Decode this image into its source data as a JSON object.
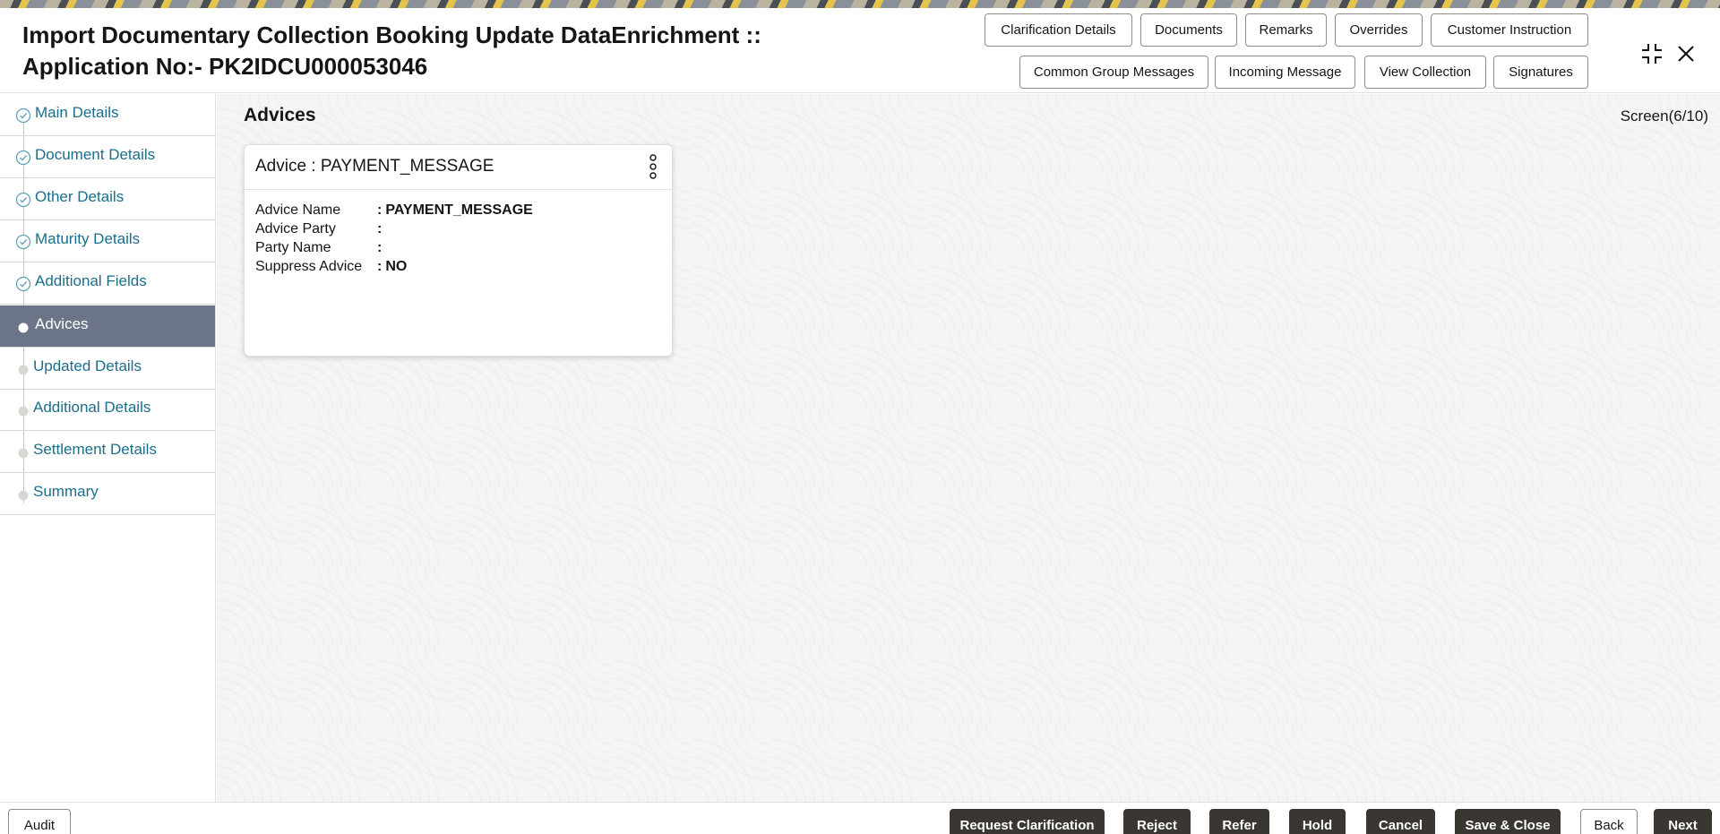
{
  "header": {
    "title_line1": "Import Documentary Collection Booking Update DataEnrichment ::",
    "title_line2": "Application No:- PK2IDCU000053046",
    "buttons_row1": [
      "Clarification Details",
      "Documents",
      "Remarks",
      "Overrides",
      "Customer Instruction"
    ],
    "buttons_row2": [
      "Common Group Messages",
      "Incoming Message",
      "View Collection",
      "Signatures"
    ],
    "window_controls": [
      "collapse-icon",
      "close-icon"
    ]
  },
  "sidebar": {
    "items": [
      {
        "label": "Main Details",
        "state": "done"
      },
      {
        "label": "Document Details",
        "state": "done"
      },
      {
        "label": "Other Details",
        "state": "done"
      },
      {
        "label": "Maturity Details",
        "state": "done"
      },
      {
        "label": "Additional Fields",
        "state": "done"
      },
      {
        "label": "Advices",
        "state": "active"
      },
      {
        "label": "Updated Details",
        "state": "pending"
      },
      {
        "label": "Additional Details",
        "state": "pending"
      },
      {
        "label": "Settlement Details",
        "state": "pending"
      },
      {
        "label": "Summary",
        "state": "pending"
      }
    ]
  },
  "main": {
    "section_title": "Advices",
    "screen_indicator": "Screen(6/10)",
    "card": {
      "title": "Advice : PAYMENT_MESSAGE",
      "fields": [
        {
          "key": "Advice Name",
          "value": "PAYMENT_MESSAGE"
        },
        {
          "key": "Advice Party",
          "value": ""
        },
        {
          "key": "Party Name",
          "value": ""
        },
        {
          "key": "Suppress Advice",
          "value": "NO"
        }
      ]
    }
  },
  "footer": {
    "audit_label": "Audit",
    "actions": [
      "Request Clarification",
      "Reject",
      "Refer",
      "Hold",
      "Cancel",
      "Save & Close",
      "Back",
      "Next"
    ]
  },
  "colors": {
    "link_text": "#1a6e8a",
    "active_nav_bg": "#6b7489",
    "dark_button": "#3a3631",
    "step_done_icon": "#5a9fb5",
    "step_pending_dot": "#d9d7d3"
  }
}
